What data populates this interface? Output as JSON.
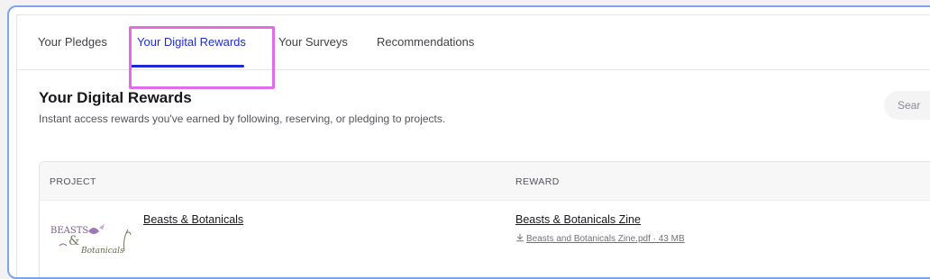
{
  "tabs": [
    {
      "label": "Your Pledges",
      "active": false
    },
    {
      "label": "Your Digital Rewards",
      "active": true
    },
    {
      "label": "Your Surveys",
      "active": false
    },
    {
      "label": "Recommendations",
      "active": false
    }
  ],
  "section": {
    "title": "Your Digital Rewards",
    "subtitle": "Instant access rewards you've earned by following, reserving, or pledging to projects."
  },
  "search": {
    "placeholder": "Sear"
  },
  "table": {
    "headers": [
      "PROJECT",
      "REWARD"
    ],
    "rows": [
      {
        "project": "Beasts & Botanicals",
        "thumbnail_text": [
          "BEASTS",
          "&",
          "Botanicals"
        ],
        "reward": "Beasts & Botanicals Zine",
        "file": "Beasts and Botanicals Zine.pdf",
        "file_size": "43 MB",
        "file_line": "Beasts and Botanicals Zine.pdf · 43 MB"
      }
    ]
  },
  "colors": {
    "accent": "#1d2bd6",
    "highlight": "#e36be8",
    "frame": "#7fa4ea"
  }
}
